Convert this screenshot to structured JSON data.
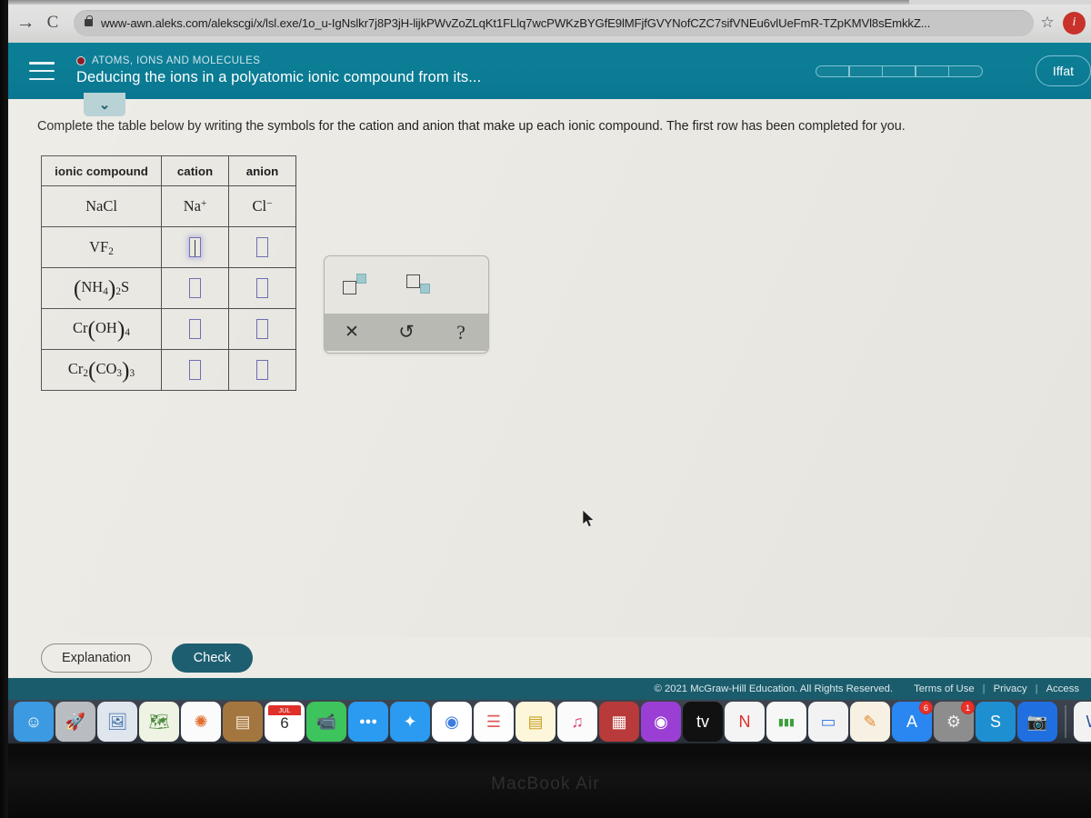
{
  "browser": {
    "back_icon": "→",
    "reload_icon": "C",
    "url": "www-awn.aleks.com/alekscgi/x/lsl.exe/1o_u-IgNslkr7j8P3jH-lijkPWvZoZLqKt1FLlq7wcPWKzBYGfE9lMFjfGVYNofCZC7sifVNEu6vlUeFmR-TZpKMVl8sEmkkZ...",
    "star_icon": "☆",
    "profile_letter": "i",
    "accent_color": "#c8322a"
  },
  "header": {
    "kicker": "ATOMS, IONS AND MOLECULES",
    "title": "Deducing the ions in a polyatomic ionic compound from its...",
    "progress_segments": 5,
    "user_label": "Iffat",
    "collapse_icon": "⌄",
    "teal_color": "#0b7f97",
    "kicker_dot_color": "#8e1c26"
  },
  "main": {
    "instruction": "Complete the table below by writing the symbols for the cation and anion that make up each ionic compound. The first row has been completed for you.",
    "table": {
      "columns": [
        "ionic compound",
        "cation",
        "anion"
      ],
      "rows": [
        {
          "compound_parts": [
            {
              "t": "NaCl",
              "k": "n"
            }
          ],
          "cation": {
            "filled": true,
            "parts": [
              {
                "t": "Na",
                "k": "n"
              },
              {
                "t": "+",
                "k": "sup"
              }
            ]
          },
          "anion": {
            "filled": true,
            "parts": [
              {
                "t": "Cl",
                "k": "n"
              },
              {
                "t": "−",
                "k": "sup"
              }
            ]
          }
        },
        {
          "compound_parts": [
            {
              "t": "VF",
              "k": "n"
            },
            {
              "t": "2",
              "k": "sub"
            }
          ],
          "cation": {
            "filled": false,
            "focused": true
          },
          "anion": {
            "filled": false,
            "focused": false
          }
        },
        {
          "compound_parts": [
            {
              "t": "(",
              "k": "paren"
            },
            {
              "t": "NH",
              "k": "n"
            },
            {
              "t": "4",
              "k": "sub"
            },
            {
              "t": ")",
              "k": "paren"
            },
            {
              "t": "2",
              "k": "sub"
            },
            {
              "t": "S",
              "k": "n"
            }
          ],
          "cation": {
            "filled": false,
            "focused": false
          },
          "anion": {
            "filled": false,
            "focused": false
          }
        },
        {
          "compound_parts": [
            {
              "t": "Cr",
              "k": "n"
            },
            {
              "t": "(",
              "k": "paren"
            },
            {
              "t": "OH",
              "k": "n"
            },
            {
              "t": ")",
              "k": "paren"
            },
            {
              "t": "4",
              "k": "sub"
            }
          ],
          "cation": {
            "filled": false,
            "focused": false
          },
          "anion": {
            "filled": false,
            "focused": false
          }
        },
        {
          "compound_parts": [
            {
              "t": "Cr",
              "k": "n"
            },
            {
              "t": "2",
              "k": "sub"
            },
            {
              "t": "(",
              "k": "paren"
            },
            {
              "t": "CO",
              "k": "n"
            },
            {
              "t": "3",
              "k": "sub"
            },
            {
              "t": ")",
              "k": "paren"
            },
            {
              "t": "3",
              "k": "sub"
            }
          ],
          "cation": {
            "filled": false,
            "focused": false
          },
          "anion": {
            "filled": false,
            "focused": false
          }
        }
      ]
    },
    "palette": {
      "superscript_label": "superscript",
      "subscript_label": "subscript",
      "clear_icon": "✕",
      "undo_icon": "↺",
      "help_icon": "?",
      "tile_color": "#9ec9ce"
    }
  },
  "actions": {
    "explanation_label": "Explanation",
    "check_label": "Check",
    "check_color": "#1d5f70"
  },
  "footer": {
    "copyright": "© 2021 McGraw-Hill Education. All Rights Reserved.",
    "links": [
      "Terms of Use",
      "Privacy",
      "Access"
    ],
    "separator": "|"
  },
  "dock": {
    "items": [
      {
        "name": "finder",
        "glyph": "☺",
        "bg": "#3b9ae1",
        "fg": "#ffffff",
        "running": true
      },
      {
        "name": "launchpad",
        "glyph": "🚀",
        "bg": "#b9bcc0",
        "fg": "#3a3a3a",
        "running": false
      },
      {
        "name": "preview",
        "glyph": "🖼",
        "bg": "#dfe6ee",
        "fg": "#3a6ea5",
        "running": false
      },
      {
        "name": "maps",
        "glyph": "🗺",
        "bg": "#eef3e4",
        "fg": "#4d8b3e",
        "running": false
      },
      {
        "name": "photos",
        "glyph": "✺",
        "bg": "#fbfbfb",
        "fg": "#e06c2d",
        "running": false
      },
      {
        "name": "contacts",
        "glyph": "▤",
        "bg": "#a4763f",
        "fg": "#f2e4cf",
        "running": false
      },
      {
        "name": "calendar",
        "glyph": "6",
        "bg": "#ffffff",
        "fg": "#2b2b2b",
        "running": false,
        "badge_top": "JUL"
      },
      {
        "name": "facetime",
        "glyph": "📹",
        "bg": "#3ec45c",
        "fg": "#ffffff",
        "running": false
      },
      {
        "name": "messages",
        "glyph": "●●●",
        "bg": "#2a9bf0",
        "fg": "#ffffff",
        "running": false
      },
      {
        "name": "safari",
        "glyph": "✦",
        "bg": "#2a9bf0",
        "fg": "#ffffff",
        "running": false
      },
      {
        "name": "chrome",
        "glyph": "◉",
        "bg": "#ffffff",
        "fg": "#3b7de0",
        "running": true
      },
      {
        "name": "reminders",
        "glyph": "☰",
        "bg": "#fdfdfd",
        "fg": "#e05b5b",
        "running": false
      },
      {
        "name": "notes",
        "glyph": "▤",
        "bg": "#fdf6da",
        "fg": "#c9a227",
        "running": false
      },
      {
        "name": "music",
        "glyph": "♫",
        "bg": "#fbfbfb",
        "fg": "#e0457b",
        "running": false
      },
      {
        "name": "photo-booth",
        "glyph": "▦",
        "bg": "#b93a3a",
        "fg": "#ffffff",
        "running": false
      },
      {
        "name": "podcasts",
        "glyph": "◉",
        "bg": "#9b3fd4",
        "fg": "#ffffff",
        "running": false
      },
      {
        "name": "apple-tv",
        "glyph": "tv",
        "bg": "#111111",
        "fg": "#ffffff",
        "running": false
      },
      {
        "name": "news",
        "glyph": "N",
        "bg": "#f4f4f4",
        "fg": "#e0302a",
        "running": false
      },
      {
        "name": "numbers",
        "glyph": "▮▮▮",
        "bg": "#f7f7f7",
        "fg": "#3aa03a",
        "running": false
      },
      {
        "name": "keynote",
        "glyph": "▭",
        "bg": "#f2f2f2",
        "fg": "#3b7de0",
        "running": false
      },
      {
        "name": "pages",
        "glyph": "✎",
        "bg": "#f7f1e4",
        "fg": "#e08b2d",
        "running": false
      },
      {
        "name": "app-store",
        "glyph": "A",
        "bg": "#2a86f0",
        "fg": "#ffffff",
        "running": false,
        "badge": "6"
      },
      {
        "name": "system-preferences",
        "glyph": "⚙",
        "bg": "#8d8d8d",
        "fg": "#f0f0f0",
        "running": false,
        "badge": "1"
      },
      {
        "name": "skype",
        "glyph": "S",
        "bg": "#1e8fd1",
        "fg": "#ffffff",
        "running": false
      },
      {
        "name": "zoom",
        "glyph": "📷",
        "bg": "#1f6fe0",
        "fg": "#ffffff",
        "running": false
      },
      {
        "name": "microsoft-word",
        "glyph": "W",
        "bg": "#f2f2f2",
        "fg": "#2b579a",
        "running": false
      }
    ]
  },
  "device": {
    "model_label": "MacBook Air"
  }
}
